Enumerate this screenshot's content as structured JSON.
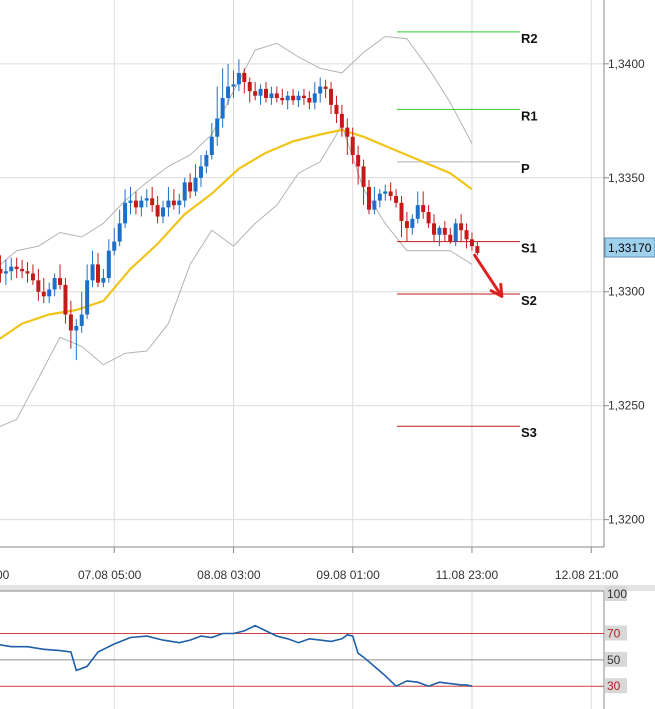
{
  "chart_data": [
    {
      "type": "candlestick",
      "title": "",
      "y_ticks": [
        "1,3400",
        "1,3350",
        "1,3300",
        "1,3250",
        "1,3200"
      ],
      "y_tick_values": [
        1.34,
        1.335,
        1.33,
        1.325,
        1.32
      ],
      "ylim": [
        1.3188,
        1.3428
      ],
      "x_ticks": [
        "00",
        "07.08 05:00",
        "08.08 03:00",
        "09.08 01:00",
        "11.08 23:00",
        "12.08 21:00"
      ],
      "x_tick_index": [
        0,
        22,
        44,
        66,
        88,
        110
      ],
      "x_index_range": [
        0,
        126
      ],
      "grid": true,
      "current_price": "1,33170",
      "current_price_value": 1.3317,
      "pivots": [
        {
          "label": "R2",
          "value": 1.3414,
          "color": "#2ecc2e"
        },
        {
          "label": "R1",
          "value": 1.338,
          "color": "#2ecc2e"
        },
        {
          "label": "P",
          "value": 1.3357,
          "color": "#b0b0b0"
        },
        {
          "label": "S1",
          "value": 1.3322,
          "color": "#c21818"
        },
        {
          "label": "S2",
          "value": 1.3299,
          "color": "#c21818"
        },
        {
          "label": "S3",
          "value": 1.3241,
          "color": "#c21818"
        }
      ],
      "forecast_arrow": {
        "from": [
          88.5,
          1.3316
        ],
        "to": [
          93.5,
          1.3298
        ],
        "color": "#e02020"
      },
      "candle_colors": {
        "up": "#1e6fc8",
        "down": "#c41a1a"
      },
      "ohlc_series": {
        "index": [
          0,
          1,
          2,
          3,
          4,
          5,
          6,
          7,
          8,
          9,
          10,
          11,
          12,
          13,
          14,
          15,
          16,
          17,
          18,
          19,
          20,
          21,
          22,
          23,
          24,
          25,
          26,
          27,
          28,
          29,
          30,
          31,
          32,
          33,
          34,
          35,
          36,
          37,
          38,
          39,
          40,
          41,
          42,
          43,
          44,
          45,
          46,
          47,
          48,
          49,
          50,
          51,
          52,
          53,
          54,
          55,
          56,
          57,
          58,
          59,
          60,
          61,
          62,
          63,
          64,
          65,
          66,
          67,
          68,
          69,
          70,
          71,
          72,
          73,
          74,
          75,
          76,
          77,
          78,
          79,
          80,
          81,
          82,
          83,
          84,
          85,
          86,
          87,
          88,
          89
        ],
        "open": [
          1.3302,
          1.331,
          1.3308,
          1.3309,
          1.3311,
          1.331,
          1.3309,
          1.3308,
          1.3305,
          1.33,
          1.3298,
          1.3301,
          1.3306,
          1.3303,
          1.329,
          1.3283,
          1.3285,
          1.329,
          1.3305,
          1.3312,
          1.3304,
          1.3306,
          1.3318,
          1.3322,
          1.333,
          1.3339,
          1.334,
          1.3337,
          1.334,
          1.3341,
          1.3338,
          1.3333,
          1.3337,
          1.334,
          1.3338,
          1.334,
          1.3348,
          1.3344,
          1.335,
          1.3355,
          1.336,
          1.3368,
          1.3376,
          1.3385,
          1.339,
          1.3391,
          1.3396,
          1.3392,
          1.3388,
          1.3386,
          1.3389,
          1.3385,
          1.3387,
          1.3385,
          1.3384,
          1.3386,
          1.3384,
          1.3386,
          1.3385,
          1.3383,
          1.3387,
          1.339,
          1.3389,
          1.3382,
          1.3378,
          1.3372,
          1.3368,
          1.336,
          1.3355,
          1.3346,
          1.3336,
          1.334,
          1.3343,
          1.3344,
          1.3342,
          1.3339,
          1.3331,
          1.3328,
          1.3332,
          1.3338,
          1.3335,
          1.333,
          1.3325,
          1.3328,
          1.3325,
          1.3322,
          1.333,
          1.3327,
          1.3323,
          1.332
        ],
        "high": [
          1.3315,
          1.3316,
          1.3314,
          1.3315,
          1.3315,
          1.3314,
          1.3313,
          1.3312,
          1.331,
          1.3306,
          1.3304,
          1.3308,
          1.3312,
          1.3306,
          1.3296,
          1.3288,
          1.33,
          1.3312,
          1.3318,
          1.3317,
          1.331,
          1.3323,
          1.3328,
          1.3336,
          1.3345,
          1.3346,
          1.3344,
          1.3342,
          1.3345,
          1.3346,
          1.3342,
          1.334,
          1.3346,
          1.3345,
          1.3343,
          1.335,
          1.3352,
          1.3356,
          1.336,
          1.3362,
          1.3374,
          1.339,
          1.3398,
          1.34,
          1.3397,
          1.3402,
          1.3398,
          1.3394,
          1.3392,
          1.3391,
          1.3392,
          1.339,
          1.339,
          1.3389,
          1.3388,
          1.3389,
          1.3388,
          1.3389,
          1.3388,
          1.3392,
          1.3394,
          1.3393,
          1.3392,
          1.3386,
          1.3382,
          1.3376,
          1.3372,
          1.3364,
          1.3358,
          1.3349,
          1.3346,
          1.3345,
          1.3347,
          1.3348,
          1.3345,
          1.3342,
          1.3335,
          1.3334,
          1.3344,
          1.3344,
          1.3338,
          1.3334,
          1.3329,
          1.3331,
          1.3328,
          1.3332,
          1.3334,
          1.333,
          1.3326,
          1.3322
        ],
        "low": [
          1.3297,
          1.3304,
          1.3303,
          1.3305,
          1.3306,
          1.3306,
          1.3304,
          1.3303,
          1.3296,
          1.3295,
          1.3295,
          1.3298,
          1.3301,
          1.3286,
          1.3275,
          1.327,
          1.3282,
          1.3288,
          1.3302,
          1.3302,
          1.3302,
          1.3304,
          1.3316,
          1.332,
          1.3328,
          1.3334,
          1.3334,
          1.3333,
          1.3337,
          1.3335,
          1.333,
          1.333,
          1.3333,
          1.3336,
          1.3334,
          1.3337,
          1.3341,
          1.3342,
          1.3346,
          1.3352,
          1.3358,
          1.3364,
          1.3372,
          1.3382,
          1.3385,
          1.3388,
          1.3387,
          1.3383,
          1.3384,
          1.3382,
          1.3383,
          1.3382,
          1.3383,
          1.3382,
          1.338,
          1.3382,
          1.3381,
          1.3382,
          1.338,
          1.338,
          1.3383,
          1.3385,
          1.3378,
          1.3374,
          1.3368,
          1.336,
          1.3356,
          1.3347,
          1.3338,
          1.3334,
          1.3334,
          1.3337,
          1.334,
          1.334,
          1.3337,
          1.3324,
          1.3322,
          1.3325,
          1.333,
          1.3332,
          1.3328,
          1.3322,
          1.332,
          1.3322,
          1.3321,
          1.332,
          1.3322,
          1.3319,
          1.3318,
          1.3316
        ],
        "close": [
          1.331,
          1.3308,
          1.3309,
          1.3311,
          1.331,
          1.3309,
          1.3308,
          1.3305,
          1.33,
          1.3298,
          1.3301,
          1.3306,
          1.3303,
          1.329,
          1.3283,
          1.3285,
          1.329,
          1.3305,
          1.3312,
          1.3304,
          1.3306,
          1.3318,
          1.3322,
          1.333,
          1.3339,
          1.334,
          1.3337,
          1.334,
          1.3341,
          1.3338,
          1.3333,
          1.3337,
          1.334,
          1.3338,
          1.334,
          1.3348,
          1.3344,
          1.335,
          1.3355,
          1.336,
          1.3368,
          1.3376,
          1.3385,
          1.339,
          1.3391,
          1.3396,
          1.3392,
          1.3388,
          1.3386,
          1.3389,
          1.3385,
          1.3387,
          1.3385,
          1.3384,
          1.3386,
          1.3384,
          1.3386,
          1.3385,
          1.3383,
          1.3387,
          1.339,
          1.3389,
          1.3382,
          1.3378,
          1.3372,
          1.3368,
          1.336,
          1.3355,
          1.3346,
          1.3336,
          1.334,
          1.3343,
          1.3344,
          1.3342,
          1.3339,
          1.3331,
          1.3328,
          1.3332,
          1.3338,
          1.3335,
          1.333,
          1.3325,
          1.3328,
          1.3325,
          1.3322,
          1.333,
          1.3327,
          1.3323,
          1.332,
          1.3317
        ]
      },
      "overlay_series": [
        {
          "role": "moving-average",
          "color": "#f0c419",
          "x": [
            0,
            5,
            10,
            15,
            20,
            25,
            30,
            35,
            40,
            45,
            50,
            55,
            60,
            64,
            68,
            72,
            76,
            80,
            84,
            88
          ],
          "y": [
            1.3278,
            1.3286,
            1.329,
            1.3292,
            1.3296,
            1.331,
            1.3321,
            1.3334,
            1.3343,
            1.3354,
            1.3361,
            1.3366,
            1.3369,
            1.3371,
            1.3368,
            1.3364,
            1.336,
            1.3356,
            1.3352,
            1.3345
          ]
        },
        {
          "role": "bollinger-upper",
          "color": "#b4b4b4",
          "x": [
            0,
            4,
            8,
            12,
            16,
            20,
            24,
            28,
            32,
            36,
            40,
            44,
            48,
            52,
            56,
            60,
            64,
            68,
            72,
            76,
            80,
            84,
            88
          ],
          "y": [
            1.331,
            1.3318,
            1.332,
            1.3326,
            1.3324,
            1.333,
            1.334,
            1.3348,
            1.3355,
            1.336,
            1.3369,
            1.3388,
            1.3406,
            1.3409,
            1.3403,
            1.3398,
            1.3396,
            1.3405,
            1.3412,
            1.3411,
            1.3398,
            1.3383,
            1.3365
          ]
        },
        {
          "role": "bollinger-lower",
          "color": "#b4b4b4",
          "x": [
            0,
            4,
            8,
            12,
            16,
            20,
            24,
            28,
            32,
            36,
            40,
            44,
            48,
            52,
            56,
            60,
            64,
            68,
            72,
            76,
            80,
            84,
            88
          ],
          "y": [
            1.324,
            1.3244,
            1.3262,
            1.328,
            1.3276,
            1.3268,
            1.3273,
            1.3274,
            1.3286,
            1.3312,
            1.3327,
            1.332,
            1.333,
            1.3338,
            1.3352,
            1.3357,
            1.3373,
            1.3345,
            1.333,
            1.3318,
            1.3318,
            1.3318,
            1.3312
          ]
        }
      ]
    },
    {
      "type": "line",
      "title": "",
      "y_ticks": [
        "100",
        "70",
        "50",
        "30"
      ],
      "y_tick_values": [
        100,
        70,
        50,
        30
      ],
      "ylim": [
        18,
        100
      ],
      "reference_lines": [
        {
          "value": 70,
          "color": "#d04040"
        },
        {
          "value": 50,
          "color": "#909090"
        },
        {
          "value": 30,
          "color": "#d04040"
        }
      ],
      "series": [
        {
          "color": "#1f5fa8",
          "x": [
            0,
            3,
            6,
            9,
            12,
            14,
            15,
            17,
            19,
            22,
            25,
            28,
            31,
            34,
            36,
            38,
            40,
            42,
            44,
            46,
            48,
            50,
            52,
            54,
            56,
            58,
            60,
            62,
            63,
            64,
            65,
            66,
            67,
            68,
            70,
            72,
            74,
            76,
            78,
            80,
            82,
            84,
            86,
            87,
            88
          ],
          "y": [
            62,
            60,
            60,
            58,
            57,
            56,
            42,
            45,
            56,
            62,
            67,
            68,
            65,
            63,
            65,
            68,
            67,
            70,
            70,
            72,
            76,
            72,
            68,
            66,
            63,
            66,
            65,
            64,
            65,
            66,
            69,
            68,
            55,
            52,
            45,
            38,
            30,
            34,
            33,
            30,
            33,
            32,
            31,
            31,
            30
          ]
        }
      ]
    }
  ]
}
